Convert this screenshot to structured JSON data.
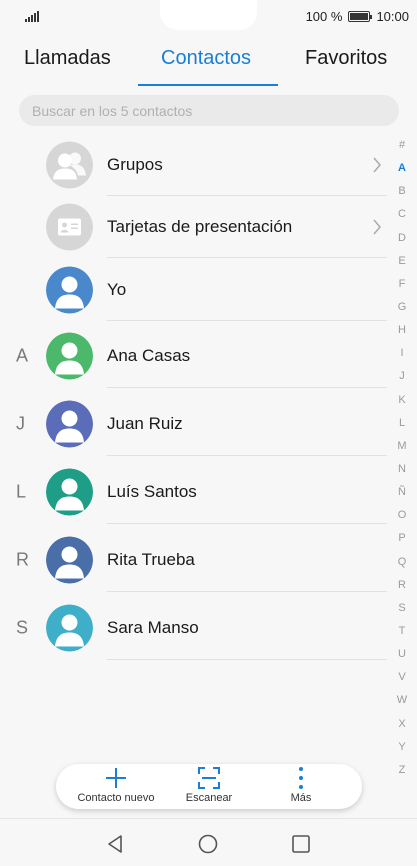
{
  "status": {
    "battery_percent": "100 %",
    "battery_level": 1.0,
    "time": "10:00"
  },
  "tabs": [
    {
      "label": "Llamadas",
      "active": false
    },
    {
      "label": "Contactos",
      "active": true
    },
    {
      "label": "Favoritos",
      "active": false
    }
  ],
  "search": {
    "placeholder": "Buscar en los 5 contactos"
  },
  "special_items": [
    {
      "label": "Grupos",
      "icon": "group-avatar-icon",
      "has_chevron": true
    },
    {
      "label": "Tarjetas de presentación",
      "icon": "business-card-icon",
      "has_chevron": true
    },
    {
      "label": "Yo",
      "icon": "person-avatar-icon",
      "has_chevron": false
    }
  ],
  "contacts": [
    {
      "letter": "A",
      "name": "Ana Casas",
      "color": "#4cb86c"
    },
    {
      "letter": "J",
      "name": "Juan Ruiz",
      "color": "#5b6cb8"
    },
    {
      "letter": "L",
      "name": "Luís Santos",
      "color": "#1e9e86"
    },
    {
      "letter": "R",
      "name": "Rita Trueba",
      "color": "#4a6fa8"
    },
    {
      "letter": "S",
      "name": "Sara Manso",
      "color": "#3eaec9"
    }
  ],
  "me_color": "#4a88cc",
  "placeholder_avatar_color": "#d6d6d6",
  "accent_color": "#1a7fd4",
  "alphabet_index": [
    "#",
    "A",
    "B",
    "C",
    "D",
    "E",
    "F",
    "G",
    "H",
    "I",
    "J",
    "K",
    "L",
    "M",
    "N",
    "Ñ",
    "O",
    "P",
    "Q",
    "R",
    "S",
    "T",
    "U",
    "V",
    "W",
    "X",
    "Y",
    "Z"
  ],
  "alphabet_active": "A",
  "toolbar": {
    "new_contact_label": "Contacto nuevo",
    "scan_label": "Escanear",
    "more_label": "Más"
  },
  "navbar": {
    "back": "back-icon",
    "home": "home-icon",
    "recents": "recents-icon"
  }
}
